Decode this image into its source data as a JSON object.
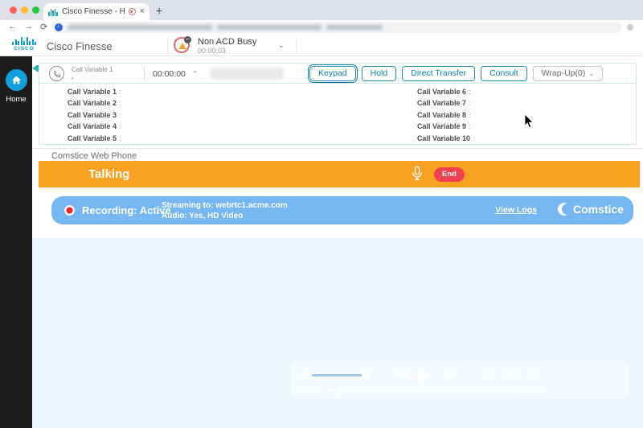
{
  "browser": {
    "tab_title": "Cisco Finesse - Home",
    "tab_close": "×",
    "new_tab": "+",
    "back": "←",
    "forward": "→",
    "reload": "⟳"
  },
  "finesse_header": {
    "app_title": "Cisco Finesse",
    "agent_state": {
      "label": "Non ACD Busy",
      "timer": "00:00:03",
      "badge": "–",
      "chevron": "⌄"
    }
  },
  "sidebar": {
    "home_label": "Home"
  },
  "call_bar": {
    "variable_label": "Call Variable 1",
    "variable_value": "-",
    "timer": "00:00:00",
    "collapse_chevron": "⌃",
    "buttons": {
      "keypad": "Keypad",
      "hold": "Hold",
      "direct_transfer": "Direct Transfer",
      "consult": "Consult",
      "wrapup": "Wrap-Up(0)",
      "wrapup_chevron": "⌄"
    }
  },
  "call_variables": {
    "separator": ":",
    "left": [
      "Call Variable 1",
      "Call Variable 2",
      "Call Variable 3",
      "Call Variable 4",
      "Call Variable 5"
    ],
    "right": [
      "Call Variable 6",
      "Call Variable 7",
      "Call Variable 8",
      "Call Variable 9",
      "Call Variable 10"
    ]
  },
  "webphone": {
    "title": "Comstice Web Phone",
    "call_status": "Talking",
    "end_button": "End",
    "recording_banner": {
      "status": "Recording: Active",
      "stream_line": "Streaming to: webrtc1.acme.com",
      "audio_line": "Audio: Yes, HD Video",
      "view_logs": "View Logs",
      "brand": "Comstice"
    }
  },
  "player": {
    "elapsed": "00:05",
    "duration": "01:08",
    "rewind": "◀◀",
    "play": "▶",
    "forward": "▶▶",
    "more": "»"
  },
  "colors": {
    "cisco_blue": "#049FD9",
    "accent_orange": "#F6A11F",
    "banner_blue": "#74B7F2",
    "button_blue": "#0E7CA3",
    "end_red": "#F2404E",
    "sidebar_black": "#1D1D1D"
  }
}
